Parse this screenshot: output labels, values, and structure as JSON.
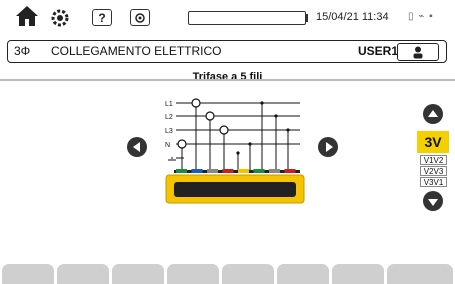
{
  "status_bar": {
    "datetime": "15/04/21 11:34",
    "buttons": [
      {
        "name": "home-icon",
        "glyph": "⌂"
      },
      {
        "name": "gear-icon",
        "glyph": "⚙"
      },
      {
        "name": "help-icon",
        "glyph": "?"
      },
      {
        "name": "camera-icon",
        "glyph": "◎"
      }
    ],
    "status_icons": "▯ ⌁ ▪"
  },
  "header": {
    "phase": "3Φ",
    "title": "COLLEGAMENTO ELETTRICO",
    "user": "USER1"
  },
  "diagram": {
    "subtitle": "Trifase a 5 fili",
    "line_labels": [
      "L1",
      "L2",
      "L3",
      "N"
    ],
    "colors": {
      "probe_body": "#f5c400",
      "connector_dark": "#222222",
      "terminals": [
        "#1a8f3c",
        "#1560bd",
        "#888888",
        "#cc1f1f",
        "#f5c400",
        "#1a8f3c",
        "#888888",
        "#cc1f1f"
      ]
    }
  },
  "modes": {
    "selected": "3V",
    "options": [
      "V1V2",
      "V2V3",
      "V3V1"
    ]
  },
  "softkeys": [
    "",
    "",
    "",
    "",
    "",
    "",
    "",
    "",
    ""
  ]
}
